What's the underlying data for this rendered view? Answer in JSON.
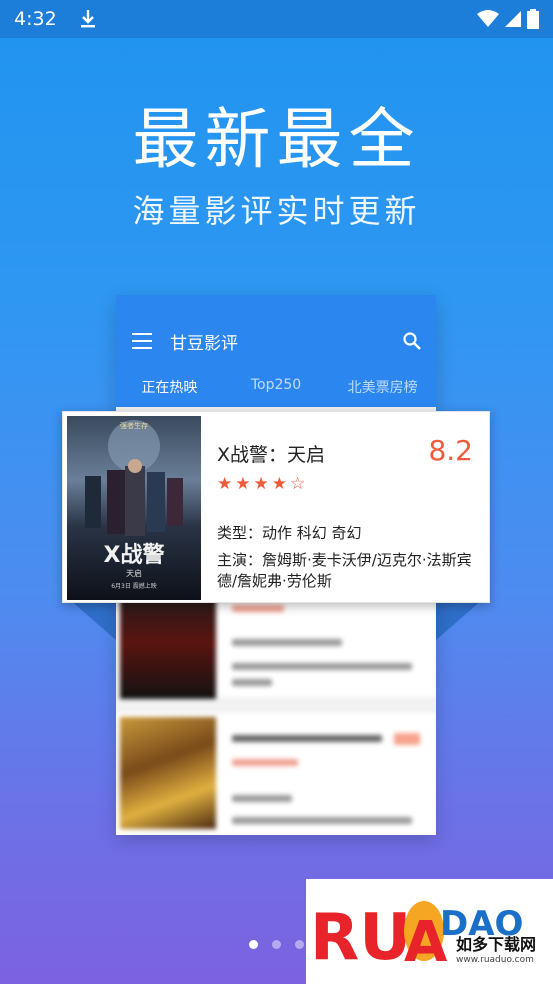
{
  "status_bar": {
    "time": "4:32",
    "icons": [
      "download-icon",
      "wifi-icon",
      "signal-icon",
      "battery-icon"
    ]
  },
  "hero": {
    "title": "最新最全",
    "subtitle": "海量影评实时更新"
  },
  "app": {
    "title": "甘豆影评",
    "tabs": [
      {
        "label": "正在热映",
        "active": true
      },
      {
        "label": "Top250",
        "active": false
      },
      {
        "label": "北美票房榜",
        "active": false
      }
    ]
  },
  "featured_movie": {
    "title": "X战警：天启",
    "score": "8.2",
    "stars": "★★★★☆",
    "star_rating": 4,
    "genre": "类型：动作 科幻 奇幻",
    "cast": "主演：詹姆斯·麦卡沃伊/迈克尔·法斯宾德/詹妮弗·劳伦斯",
    "poster": {
      "tagline": "强者生存",
      "title": "X战警",
      "subtitle": "天启",
      "release": "6月3日 震撼上映"
    }
  },
  "pager": {
    "count": 3,
    "active_index": 0
  },
  "watermark": {
    "logo": "RUAN DAO",
    "text": "如多下载网",
    "url": "www.ruaduo.com"
  },
  "colors": {
    "accent": "#2b86f0",
    "score": "#f05a3c",
    "status_bar": "#1c7ed8"
  }
}
